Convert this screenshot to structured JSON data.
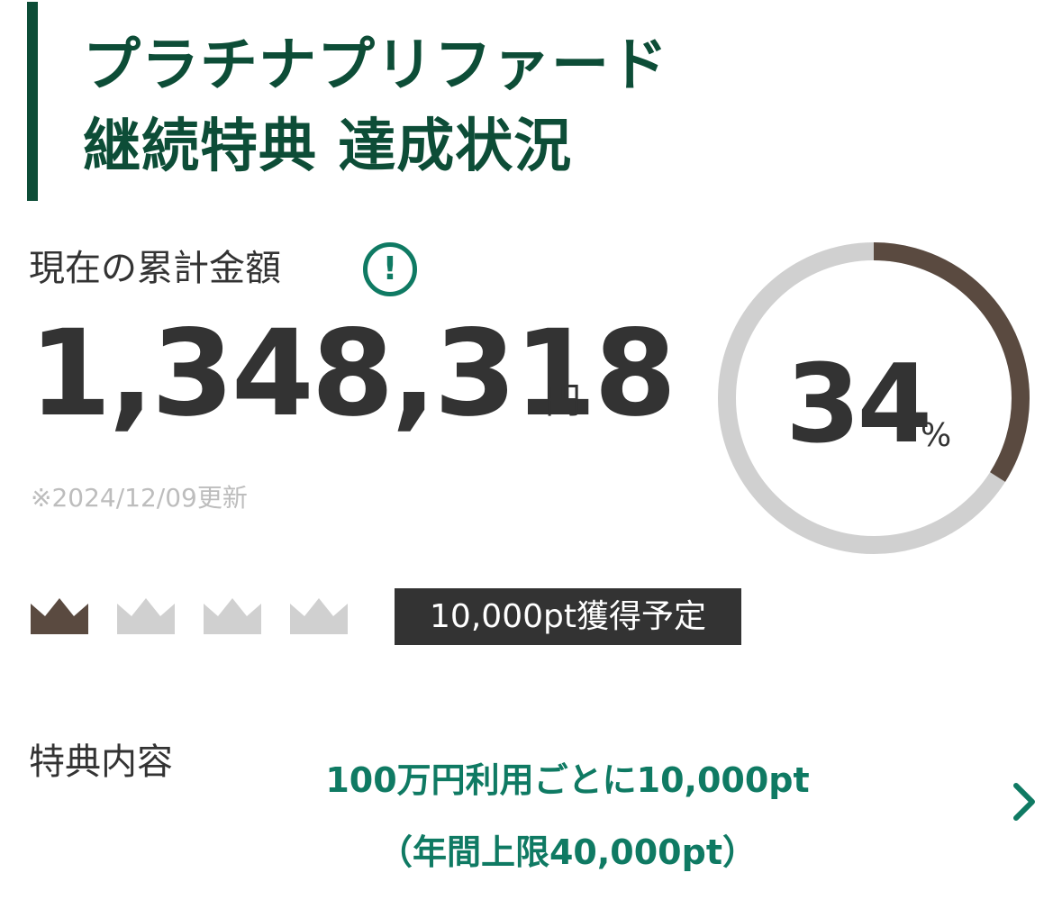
{
  "header": {
    "title_line1": "プラチナプリファード",
    "title_line2": "継続特典 達成状況"
  },
  "summary": {
    "label": "現在の累計金額",
    "info_icon": "info-icon",
    "amount": "1,348,318",
    "unit": "円",
    "updated_note": "※2024/12/09更新"
  },
  "progress": {
    "value": 0.34,
    "number": "34",
    "sign": "%",
    "color_fill": "#5a4a40",
    "color_track": "#d0d0d0"
  },
  "crowns": {
    "icon": "crown-icon",
    "total": 4,
    "achieved": 1,
    "color_achieved": "#5a4a40",
    "color_pending": "#d0d0d0"
  },
  "badge": {
    "label": "10,000pt獲得予定"
  },
  "benefit": {
    "label": "特典内容",
    "value_line1": "100万円利用ごとに10,000pt",
    "value_line2": "（年間上限40,000pt）",
    "chevron_icon": "chevron-right-icon"
  },
  "colors": {
    "brand_green": "#0d4d37",
    "accent_green": "#0f7a63",
    "text": "#333333"
  }
}
